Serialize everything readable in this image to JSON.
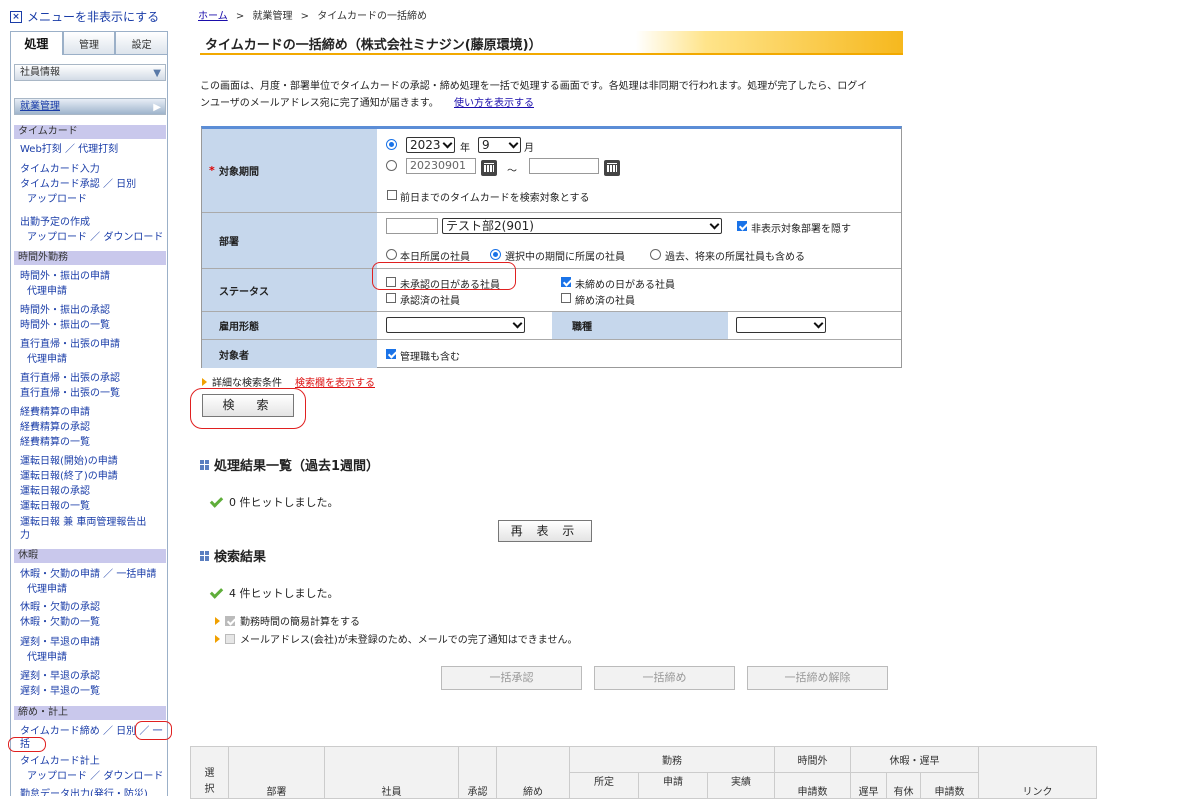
{
  "sidebar": {
    "hide_menu": "メニューを非表示にする",
    "tabs": [
      "処理",
      "管理",
      "設定"
    ],
    "employee_info": "社員情報",
    "work_mgmt": "就業管理",
    "cat_timecard": "タイムカード",
    "cat_overtime": "時間外勤務",
    "cat_leave": "休暇",
    "cat_close": "締め・計上",
    "links": {
      "web_punch": "Web打刻 ／ 代理打刻",
      "tc_input": "タイムカード入力",
      "tc_approve": "タイムカード承認 ／ 日別",
      "tc_upload": "アップロード",
      "schedule": "出勤予定の作成",
      "schedule_updown": "アップロード ／ ダウンロード",
      "ot_apply": "時間外・振出の申請",
      "ot_proxy": "代理申請",
      "ot_approve": "時間外・振出の承認",
      "ot_list": "時間外・振出の一覧",
      "direct_apply": "直行直帰・出張の申請",
      "direct_proxy": "代理申請",
      "direct_approve": "直行直帰・出張の承認",
      "direct_list": "直行直帰・出張の一覧",
      "expense_apply": "経費精算の申請",
      "expense_approve": "経費精算の承認",
      "expense_list": "経費精算の一覧",
      "drive_start": "運転日報(開始)の申請",
      "drive_end": "運転日報(終了)の申請",
      "drive_approve": "運転日報の承認",
      "drive_list": "運転日報の一覧",
      "drive_vehicle_1": "運転日報 兼 車両管理報告出",
      "drive_vehicle_2": "力",
      "leave_apply": "休暇・欠勤の申請 ／ 一括申請",
      "leave_proxy": "代理申請",
      "leave_approve": "休暇・欠勤の承認",
      "leave_list": "休暇・欠勤の一覧",
      "late_apply": "遅刻・早退の申請",
      "late_proxy": "代理申請",
      "late_approve": "遅刻・早退の承認",
      "late_list": "遅刻・早退の一覧",
      "tc_close_1": "タイムカード締め ／ 日別 ／ 一",
      "tc_close_2": "括",
      "tc_post": "タイムカード計上",
      "tc_post_updown": "アップロード ／ ダウンロード",
      "cut": "勤怠データ出力(発行・防災)"
    }
  },
  "breadcrumb": {
    "home": "ホーム",
    "sep": ">",
    "mid": "就業管理",
    "current": "タイムカードの一括締め"
  },
  "page_title": "タイムカードの一括締め（株式会社ミナジン(藤原環境)）",
  "description": {
    "text1": "この画面は、月度・部署単位でタイムカードの承認・締め処理を一括で処理する画面です。各処理は非同期で行われます。処理が完了したら、ログイ",
    "text2": "ンユーザのメールアドレス宛に完了通知が届きます。",
    "help_link": "使い方を表示する"
  },
  "form": {
    "period": {
      "label": "対象期間",
      "required_mark": "*",
      "year": "2023",
      "year_unit": "年",
      "month": "9",
      "month_unit": "月",
      "date_from": "20230901",
      "tilde": "～",
      "date_to": "",
      "include_prev": "前日までのタイムカードを検索対象とする"
    },
    "dept": {
      "label": "部署",
      "code": "",
      "selected": "テスト部2(901)",
      "hide_excluded": "非表示対象部署を隠す",
      "radio_current": "本日所属の社員",
      "radio_period": "選択中の期間に所属の社員",
      "radio_all": "過去、将来の所属社員も含める"
    },
    "status": {
      "label": "ステータス",
      "unapproved": "未承認の日がある社員",
      "unclosed": "未締めの日がある社員",
      "approved": "承認済の社員",
      "closed": "締め済の社員"
    },
    "employment_type": {
      "label": "雇用形態",
      "value": ""
    },
    "job_type": {
      "label": "職種",
      "value": ""
    },
    "target": {
      "label": "対象者",
      "include_managers": "管理職も含む"
    }
  },
  "detail_search": {
    "label": "詳細な検索条件",
    "link": "検索欄を表示する"
  },
  "search_button": "検　索",
  "history": {
    "title": "処理結果一覧（過去1週間）",
    "hits": "0 件ヒットしました。",
    "refresh_button": "再 表 示"
  },
  "results": {
    "title": "検索結果",
    "hits": "4 件ヒットしました。",
    "opt_simple_calc": "勤務時間の簡易計算をする",
    "opt_mail_notice": "メールアドレス(会社)が未登録のため、メールでの完了通知はできません。",
    "btn_bulk_approve": "一括承認",
    "btn_bulk_close": "一括締め",
    "btn_bulk_unclose": "一括締め解除"
  },
  "table": {
    "select_1": "選",
    "select_2": "択",
    "dept": "部署",
    "employee": "社員",
    "approval": "承認",
    "close": "締め",
    "work": "勤務",
    "scheduled": "所定",
    "applied": "申請",
    "actual": "実績",
    "overtime": "時間外",
    "ot_apply_count": "申請数",
    "leave_late": "休暇・遅早",
    "late": "遅早",
    "paid": "有休",
    "leave_apply_count": "申請数",
    "link": "リンク"
  },
  "colors": {
    "label_bg": "#c6d7ec",
    "category_bg": "#c9c8ec",
    "accent_blue": "#5b8dd6",
    "title_gradient": "#f6b81e",
    "annotation_red": "#e02020"
  }
}
